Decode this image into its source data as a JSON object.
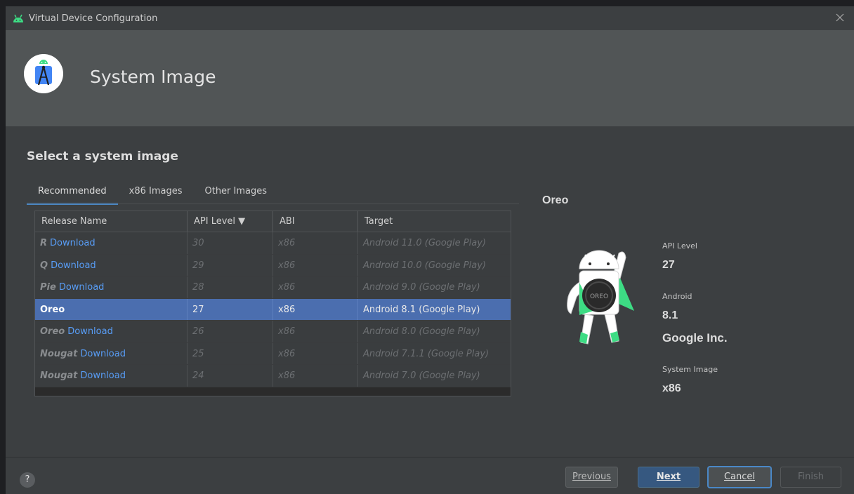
{
  "window": {
    "title": "Virtual Device Configuration"
  },
  "header": {
    "title": "System Image"
  },
  "section": {
    "title": "Select a system image"
  },
  "tabs": [
    "Recommended",
    "x86 Images",
    "Other Images"
  ],
  "table": {
    "columns": [
      "Release Name",
      "API Level ▼",
      "ABI",
      "Target"
    ],
    "rows": [
      {
        "release": "R",
        "action": "Download",
        "api": "30",
        "abi": "x86",
        "target": "Android 11.0 (Google Play)"
      },
      {
        "release": "Q",
        "action": "Download",
        "api": "29",
        "abi": "x86",
        "target": "Android 10.0 (Google Play)"
      },
      {
        "release": "Pie",
        "action": "Download",
        "api": "28",
        "abi": "x86",
        "target": "Android 9.0 (Google Play)"
      },
      {
        "release": "Oreo",
        "action": "",
        "api": "27",
        "abi": "x86",
        "target": "Android 8.1 (Google Play)"
      },
      {
        "release": "Oreo",
        "action": "Download",
        "api": "26",
        "abi": "x86",
        "target": "Android 8.0 (Google Play)"
      },
      {
        "release": "Nougat",
        "action": "Download",
        "api": "25",
        "abi": "x86",
        "target": "Android 7.1.1 (Google Play)"
      },
      {
        "release": "Nougat",
        "action": "Download",
        "api": "24",
        "abi": "x86",
        "target": "Android 7.0 (Google Play)"
      }
    ]
  },
  "detail": {
    "title": "Oreo",
    "api_label": "API Level",
    "api_value": "27",
    "android_label": "Android",
    "android_version": "8.1",
    "vendor": "Google Inc.",
    "system_image_label": "System Image",
    "system_image_value": "x86"
  },
  "buttons": {
    "help": "?",
    "previous": "Previous",
    "next": "Next",
    "cancel": "Cancel",
    "finish": "Finish"
  },
  "colors": {
    "accent": "#4a88c7",
    "selection": "#4b6eaf",
    "link": "#589df6",
    "android_green": "#3ddc84"
  }
}
